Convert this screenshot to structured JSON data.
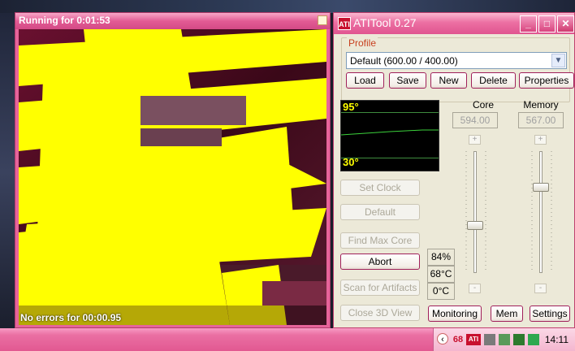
{
  "stress_window": {
    "title": "Running for 0:01:53",
    "status": "No errors for 00:00.95"
  },
  "ati": {
    "title": "ATITool 0.27",
    "logo_text": "ATI",
    "min": "_",
    "max": "□",
    "close": "✕",
    "profile": {
      "label": "Profile",
      "selected": "Default (600.00 / 400.00)",
      "dropdown_icon": "chevron-down-icon",
      "buttons": {
        "load": "Load",
        "save": "Save",
        "new": "New",
        "delete": "Delete",
        "properties": "Properties"
      }
    },
    "temp_graph": {
      "max_label": "95°",
      "min_label": "30°"
    },
    "core": {
      "label": "Core",
      "value": "594.00",
      "plus": "+",
      "minus": "-",
      "slider_level": 0.62
    },
    "memory": {
      "label": "Memory",
      "value": "567.00",
      "plus": "+",
      "minus": "-",
      "slider_level": 0.28
    },
    "buttons": {
      "set_clock": "Set Clock",
      "default": "Default",
      "find_max_core": "Find Max Core",
      "abort": "Abort",
      "scan_artifacts": "Scan for Artifacts",
      "close_3d": "Close 3D View",
      "monitoring": "Monitoring",
      "mem": "Mem",
      "settings": "Settings"
    },
    "info": {
      "load": "84%",
      "temp": "68°C",
      "other_temp": "0°C"
    }
  },
  "taskbar": {
    "tray_temp": "68",
    "tray_ati": "ATI",
    "clock": "14:11",
    "colors": {
      "accent": "#e25891",
      "tray": "#f4b6cf"
    }
  }
}
